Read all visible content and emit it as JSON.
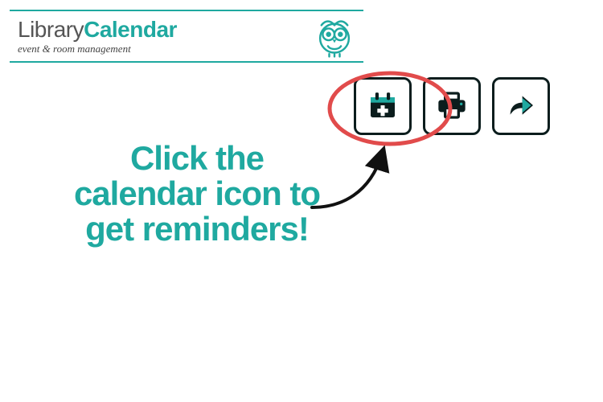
{
  "logo": {
    "word1": "Library",
    "word2": "Calendar",
    "tagline": "event & room management"
  },
  "callout_text": "Click the calendar icon to get reminders!",
  "colors": {
    "teal": "#1fa9a0",
    "dark": "#0b1d1d",
    "highlight": "#e14b4b"
  }
}
